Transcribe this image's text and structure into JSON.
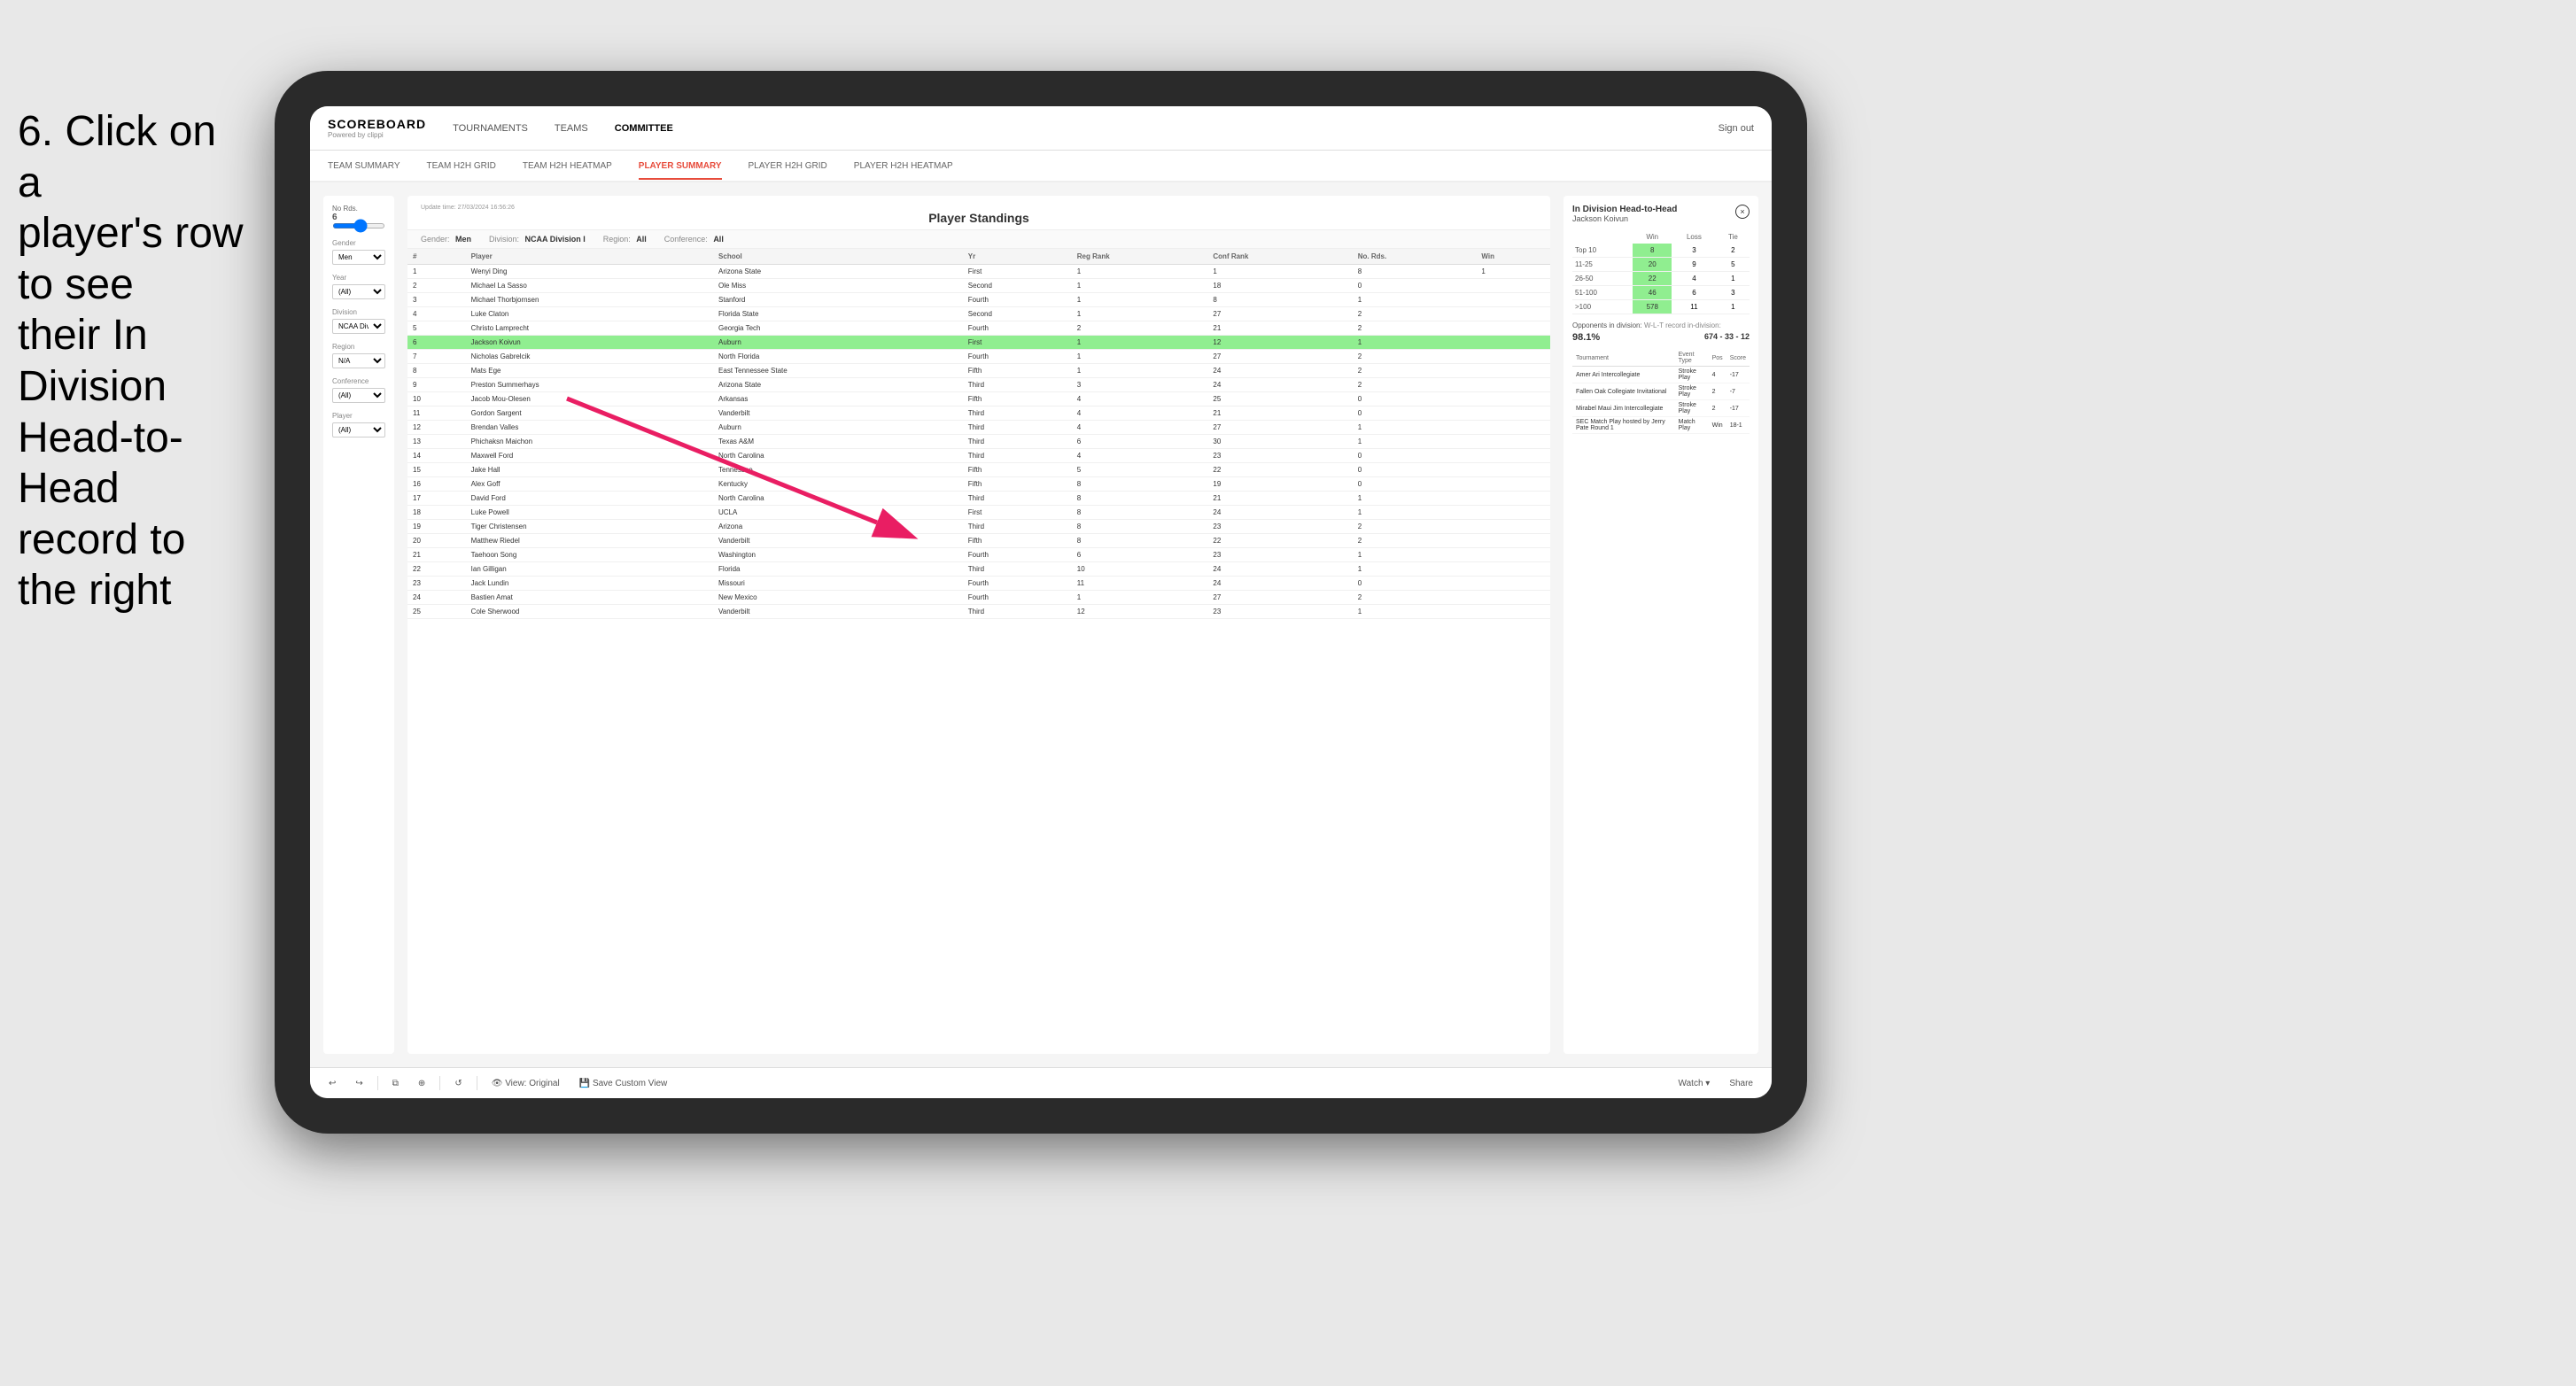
{
  "instruction": {
    "line1": "6. Click on a",
    "line2": "player's row to see",
    "line3": "their In Division",
    "line4": "Head-to-Head",
    "line5": "record to the right"
  },
  "nav": {
    "logo": "SCOREBOARD",
    "logo_sub": "Powered by clippi",
    "items": [
      "TOURNAMENTS",
      "TEAMS",
      "COMMITTEE"
    ],
    "sign_out": "Sign out"
  },
  "sub_nav": {
    "items": [
      "TEAM SUMMARY",
      "TEAM H2H GRID",
      "TEAM H2H HEATMAP",
      "PLAYER SUMMARY",
      "PLAYER H2H GRID",
      "PLAYER H2H HEATMAP"
    ],
    "active": "PLAYER SUMMARY"
  },
  "table": {
    "title": "Player Standings",
    "update_time": "Update time:",
    "update_date": "27/03/2024 16:56:26",
    "filters": {
      "gender": "Men",
      "division": "NCAA Division I",
      "region": "All",
      "conference": "All"
    },
    "columns": [
      "#",
      "Player",
      "School",
      "Yr",
      "Reg Rank",
      "Conf Rank",
      "No. Rds.",
      "Win"
    ],
    "rows": [
      {
        "num": 1,
        "player": "Wenyi Ding",
        "school": "Arizona State",
        "yr": "First",
        "reg": 1,
        "conf": 1,
        "rds": 8,
        "win": 1
      },
      {
        "num": 2,
        "player": "Michael La Sasso",
        "school": "Ole Miss",
        "yr": "Second",
        "reg": 1,
        "conf": 18,
        "rds": 0,
        "win": ""
      },
      {
        "num": 3,
        "player": "Michael Thorbjornsen",
        "school": "Stanford",
        "yr": "Fourth",
        "reg": 1,
        "conf": 8,
        "rds": 1,
        "win": ""
      },
      {
        "num": 4,
        "player": "Luke Claton",
        "school": "Florida State",
        "yr": "Second",
        "reg": 1,
        "conf": 27,
        "rds": 2,
        "win": ""
      },
      {
        "num": 5,
        "player": "Christo Lamprecht",
        "school": "Georgia Tech",
        "yr": "Fourth",
        "reg": 2,
        "conf": 21,
        "rds": 2,
        "win": ""
      },
      {
        "num": 6,
        "player": "Jackson Koivun",
        "school": "Auburn",
        "yr": "First",
        "reg": 1,
        "conf": 12,
        "rds": 1,
        "win": "",
        "highlighted": true
      },
      {
        "num": 7,
        "player": "Nicholas Gabrelcik",
        "school": "North Florida",
        "yr": "Fourth",
        "reg": 1,
        "conf": 27,
        "rds": 2,
        "win": ""
      },
      {
        "num": 8,
        "player": "Mats Ege",
        "school": "East Tennessee State",
        "yr": "Fifth",
        "reg": 1,
        "conf": 24,
        "rds": 2,
        "win": ""
      },
      {
        "num": 9,
        "player": "Preston Summerhays",
        "school": "Arizona State",
        "yr": "Third",
        "reg": 3,
        "conf": 24,
        "rds": 2,
        "win": ""
      },
      {
        "num": 10,
        "player": "Jacob Mou-Olesen",
        "school": "Arkansas",
        "yr": "Fifth",
        "reg": 4,
        "conf": 25,
        "rds": 0,
        "win": ""
      },
      {
        "num": 11,
        "player": "Gordon Sargent",
        "school": "Vanderbilt",
        "yr": "Third",
        "reg": 4,
        "conf": 21,
        "rds": 0,
        "win": ""
      },
      {
        "num": 12,
        "player": "Brendan Valles",
        "school": "Auburn",
        "yr": "Third",
        "reg": 4,
        "conf": 27,
        "rds": 1,
        "win": ""
      },
      {
        "num": 13,
        "player": "Phichaksn Maichon",
        "school": "Texas A&M",
        "yr": "Third",
        "reg": 6,
        "conf": 30,
        "rds": 1,
        "win": ""
      },
      {
        "num": 14,
        "player": "Maxwell Ford",
        "school": "North Carolina",
        "yr": "Third",
        "reg": 4,
        "conf": 23,
        "rds": 0,
        "win": ""
      },
      {
        "num": 15,
        "player": "Jake Hall",
        "school": "Tennessee",
        "yr": "Fifth",
        "reg": 5,
        "conf": 22,
        "rds": 0,
        "win": ""
      },
      {
        "num": 16,
        "player": "Alex Goff",
        "school": "Kentucky",
        "yr": "Fifth",
        "reg": 8,
        "conf": 19,
        "rds": 0,
        "win": ""
      },
      {
        "num": 17,
        "player": "David Ford",
        "school": "North Carolina",
        "yr": "Third",
        "reg": 8,
        "conf": 21,
        "rds": 1,
        "win": ""
      },
      {
        "num": 18,
        "player": "Luke Powell",
        "school": "UCLA",
        "yr": "First",
        "reg": 8,
        "conf": 24,
        "rds": 1,
        "win": ""
      },
      {
        "num": 19,
        "player": "Tiger Christensen",
        "school": "Arizona",
        "yr": "Third",
        "reg": 8,
        "conf": 23,
        "rds": 2,
        "win": ""
      },
      {
        "num": 20,
        "player": "Matthew Riedel",
        "school": "Vanderbilt",
        "yr": "Fifth",
        "reg": 8,
        "conf": 22,
        "rds": 2,
        "win": ""
      },
      {
        "num": 21,
        "player": "Taehoon Song",
        "school": "Washington",
        "yr": "Fourth",
        "reg": 6,
        "conf": 23,
        "rds": 1,
        "win": ""
      },
      {
        "num": 22,
        "player": "Ian Gilligan",
        "school": "Florida",
        "yr": "Third",
        "reg": 10,
        "conf": 24,
        "rds": 1,
        "win": ""
      },
      {
        "num": 23,
        "player": "Jack Lundin",
        "school": "Missouri",
        "yr": "Fourth",
        "reg": 11,
        "conf": 24,
        "rds": 0,
        "win": ""
      },
      {
        "num": 24,
        "player": "Bastien Amat",
        "school": "New Mexico",
        "yr": "Fourth",
        "reg": 1,
        "conf": 27,
        "rds": 2,
        "win": ""
      },
      {
        "num": 25,
        "player": "Cole Sherwood",
        "school": "Vanderbilt",
        "yr": "Third",
        "reg": 12,
        "conf": 23,
        "rds": 1,
        "win": ""
      }
    ]
  },
  "filters_panel": {
    "no_rds_label": "No Rds.",
    "no_rds_value": "6",
    "gender_label": "Gender",
    "gender_value": "Men",
    "year_label": "Year",
    "year_value": "(All)",
    "division_label": "Division",
    "division_value": "NCAA Division I",
    "region_label": "Region",
    "region_value": "N/A",
    "conference_label": "Conference",
    "conference_value": "(All)",
    "player_label": "Player",
    "player_value": "(All)"
  },
  "h2h": {
    "title": "In Division Head-to-Head",
    "player": "Jackson Koivun",
    "close_label": "×",
    "columns": [
      "Win",
      "Loss",
      "Tie"
    ],
    "rows": [
      {
        "range": "Top 10",
        "win": 8,
        "loss": 3,
        "tie": 2,
        "win_highlight": true
      },
      {
        "range": "11-25",
        "win": 20,
        "loss": 9,
        "tie": 5,
        "win_highlight": true
      },
      {
        "range": "26-50",
        "win": 22,
        "loss": 4,
        "tie": 1,
        "win_highlight": true
      },
      {
        "range": "51-100",
        "win": 46,
        "loss": 6,
        "tie": 3,
        "win_highlight": true
      },
      {
        "range": ">100",
        "win": 578,
        "loss": 11,
        "tie": 1,
        "win_highlight": true
      }
    ],
    "opponents_label": "Opponents in division:",
    "opponents_pct": "98.1%",
    "wlt_label": "W-L-T record in-division:",
    "wlt_record": "674 - 33 - 12",
    "tournament_columns": [
      "Tournament",
      "Event Type",
      "Pos",
      "Score"
    ],
    "tournaments": [
      {
        "name": "Amer Ari Intercollegiate",
        "type": "Stroke Play",
        "pos": 4,
        "score": "-17"
      },
      {
        "name": "Fallen Oak Collegiate Invitational",
        "type": "Stroke Play",
        "pos": 2,
        "score": "-7"
      },
      {
        "name": "Mirabel Maui Jim Intercollegiate",
        "type": "Stroke Play",
        "pos": 2,
        "score": "-17"
      },
      {
        "name": "SEC Match Play hosted by Jerry Pate Round 1",
        "type": "Match Play",
        "pos": "Win",
        "score": "18-1"
      }
    ]
  },
  "toolbar": {
    "view_original": "View: Original",
    "save_custom": "Save Custom View",
    "watch": "Watch ▾",
    "share": "Share"
  }
}
